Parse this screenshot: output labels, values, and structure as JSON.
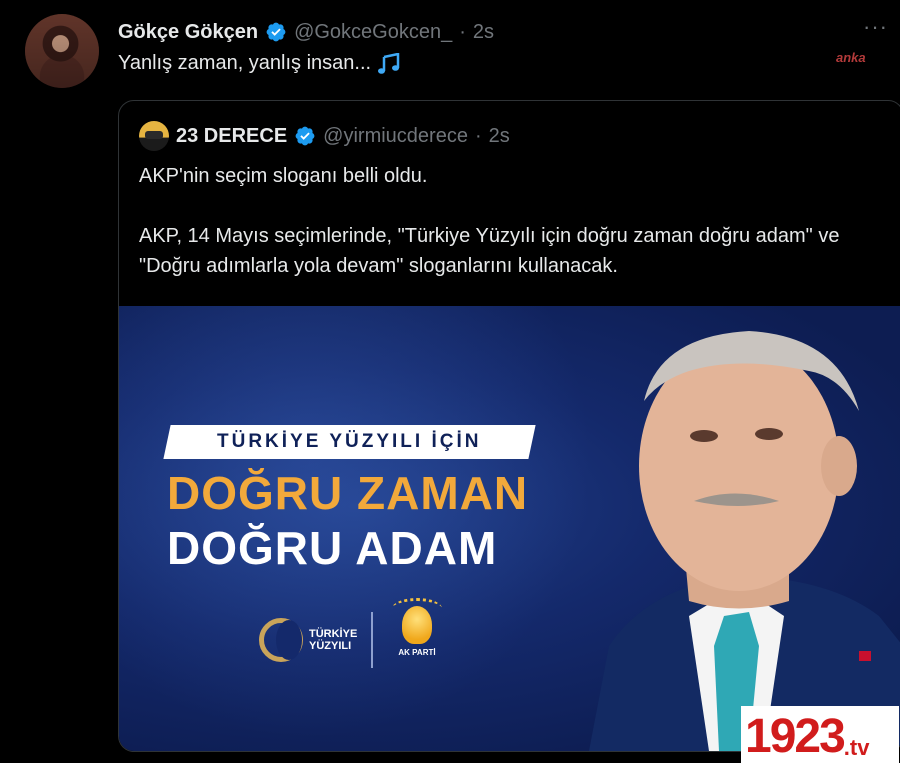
{
  "tweet": {
    "author_name": "Gökçe Gökçen",
    "handle": "@GokceGokcen_",
    "separator": "·",
    "time": "2s",
    "text": "Yanlış zaman, yanlış insan...",
    "more_label": "···"
  },
  "watermark_top": "anka",
  "quote": {
    "author_name": "23 DERECE",
    "handle": "@yirmiucderece",
    "separator": "·",
    "time": "2s",
    "paragraph1": "AKP'nin seçim sloganı belli oldu.",
    "paragraph2": "AKP, 14 Mayıs seçimlerinde, \"Türkiye Yüzyılı için doğru zaman doğru adam\" ve \"Doğru adımlarla yola devam\" sloganlarını kullanacak."
  },
  "poster": {
    "banner": "TÜRKİYE YÜZYILI İÇİN",
    "line1": "DOĞRU ZAMAN",
    "line2": "DOĞRU ADAM",
    "logo1_line1": "TÜRKİYE",
    "logo1_line2": "YÜZYILI",
    "logo2_label": "AK PARTİ"
  },
  "watermark_bottom": {
    "number": "1923",
    "suffix": ".tv"
  },
  "colors": {
    "background": "#000000",
    "text": "#e7e9ea",
    "muted": "#71767b",
    "verified": "#1d9bf0",
    "poster_bg": "#14296b",
    "poster_gold": "#f2a93b"
  },
  "icons": {
    "verified": "verified-badge-icon",
    "music": "musical-notes-icon"
  }
}
